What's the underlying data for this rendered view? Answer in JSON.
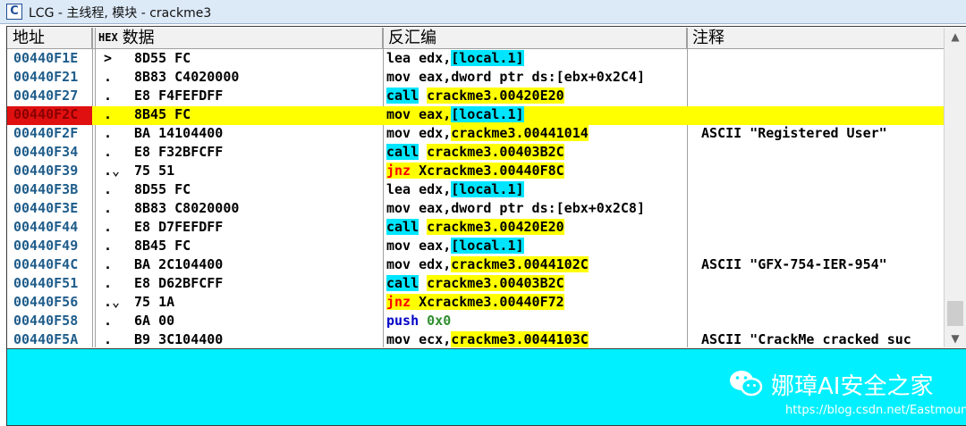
{
  "window": {
    "icon_letter": "C",
    "title": "LCG - 主线程, 模块 - crackme3"
  },
  "columns": {
    "address": "地址",
    "hex_tag": "HEX",
    "hex": "数据",
    "disasm": "反汇编",
    "comment": "注释"
  },
  "scrollbar": {
    "up": "▲",
    "down": "▼"
  },
  "rows": [
    {
      "addr": "00440F1E",
      "mark": ">",
      "hex": "8D55 FC",
      "asm": [
        {
          "t": "lea edx,"
        },
        {
          "t": "[local.1]",
          "s": "cyan"
        }
      ],
      "comment": ""
    },
    {
      "addr": "00440F21",
      "mark": ".",
      "hex": "8B83 C4020000",
      "asm": [
        {
          "t": "mov eax,dword ptr ds:[ebx+0x2C4]"
        }
      ],
      "comment": ""
    },
    {
      "addr": "00440F27",
      "mark": ".",
      "hex": "E8 F4FEFDFF",
      "asm": [
        {
          "t": "call",
          "s": "mnem-cyan"
        },
        {
          "t": " "
        },
        {
          "t": "crackme3.00420E20",
          "s": "yellow"
        }
      ],
      "comment": ""
    },
    {
      "addr": "00440F2C",
      "mark": ".",
      "hex": "8B45 FC",
      "asm": [
        {
          "t": "mov eax,"
        },
        {
          "t": "[local.1]",
          "s": "cyan"
        }
      ],
      "comment": "",
      "selected": true
    },
    {
      "addr": "00440F2F",
      "mark": ".",
      "hex": "BA 14104400",
      "asm": [
        {
          "t": "mov edx,"
        },
        {
          "t": "crackme3.00441014",
          "s": "yellow"
        }
      ],
      "comment": "ASCII \"Registered User\""
    },
    {
      "addr": "00440F34",
      "mark": ".",
      "hex": "E8 F32BFCFF",
      "asm": [
        {
          "t": "call",
          "s": "mnem-cyan"
        },
        {
          "t": " "
        },
        {
          "t": "crackme3.00403B2C",
          "s": "yellow"
        }
      ],
      "comment": ""
    },
    {
      "addr": "00440F39",
      "mark": ".⌄",
      "hex": "75 51",
      "asm": [
        {
          "t": "jnz",
          "s": "red"
        },
        {
          "t": " Xcrackme3.00440F8C",
          "s": "yellow"
        }
      ],
      "comment": ""
    },
    {
      "addr": "00440F3B",
      "mark": ".",
      "hex": "8D55 FC",
      "asm": [
        {
          "t": "lea edx,"
        },
        {
          "t": "[local.1]",
          "s": "cyan"
        }
      ],
      "comment": ""
    },
    {
      "addr": "00440F3E",
      "mark": ".",
      "hex": "8B83 C8020000",
      "asm": [
        {
          "t": "mov eax,dword ptr ds:[ebx+0x2C8]"
        }
      ],
      "comment": ""
    },
    {
      "addr": "00440F44",
      "mark": ".",
      "hex": "E8 D7FEFDFF",
      "asm": [
        {
          "t": "call",
          "s": "mnem-cyan"
        },
        {
          "t": " "
        },
        {
          "t": "crackme3.00420E20",
          "s": "yellow"
        }
      ],
      "comment": ""
    },
    {
      "addr": "00440F49",
      "mark": ".",
      "hex": "8B45 FC",
      "asm": [
        {
          "t": "mov eax,"
        },
        {
          "t": "[local.1]",
          "s": "cyan"
        }
      ],
      "comment": ""
    },
    {
      "addr": "00440F4C",
      "mark": ".",
      "hex": "BA 2C104400",
      "asm": [
        {
          "t": "mov edx,"
        },
        {
          "t": "crackme3.0044102C",
          "s": "yellow"
        }
      ],
      "comment": "ASCII \"GFX-754-IER-954\""
    },
    {
      "addr": "00440F51",
      "mark": ".",
      "hex": "E8 D62BFCFF",
      "asm": [
        {
          "t": "call",
          "s": "mnem-cyan"
        },
        {
          "t": " "
        },
        {
          "t": "crackme3.00403B2C",
          "s": "yellow"
        }
      ],
      "comment": ""
    },
    {
      "addr": "00440F56",
      "mark": ".⌄",
      "hex": "75 1A",
      "asm": [
        {
          "t": "jnz",
          "s": "red"
        },
        {
          "t": " Xcrackme3.00440F72",
          "s": "yellow"
        }
      ],
      "comment": ""
    },
    {
      "addr": "00440F58",
      "mark": ".",
      "hex": "6A 00",
      "asm": [
        {
          "t": "push",
          "s": "blue"
        },
        {
          "t": " "
        },
        {
          "t": "0x0",
          "s": "green"
        }
      ],
      "comment": ""
    },
    {
      "addr": "00440F5A",
      "mark": ".",
      "hex": "B9 3C104400",
      "asm": [
        {
          "t": "mov ecx,"
        },
        {
          "t": "crackme3.0044103C",
          "s": "yellow"
        }
      ],
      "comment": "ASCII \"CrackMe cracked suc"
    }
  ],
  "watermark": {
    "title": "娜璋AI安全之家",
    "url": "https://blog.csdn.net/Eastmount"
  },
  "colors": {
    "selected_row": "#ffff00",
    "selected_addr": "#e01010",
    "operand_highlight": "#00e5ff",
    "bottom_pane": "#00f0ff"
  }
}
